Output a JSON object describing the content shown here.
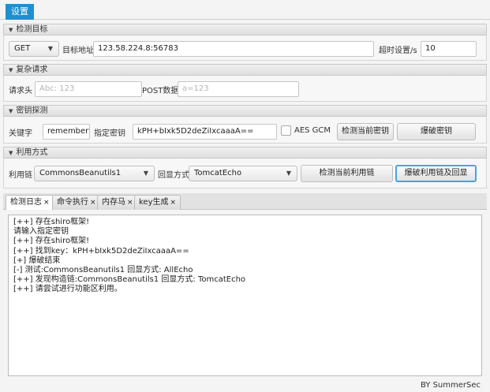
{
  "menubar": {
    "settings": "设置"
  },
  "target": {
    "header": "检测目标",
    "method": "GET",
    "url_label": "目标地址",
    "url_value": "123.58.224.8:56783",
    "timeout_label": "超时设置/s",
    "timeout_value": "10"
  },
  "complex": {
    "header": "复杂请求",
    "headers_label": "请求头",
    "headers_placeholder": "Abc: 123",
    "post_label": "POST数据",
    "post_placeholder": "a=123"
  },
  "key_probe": {
    "header": "密钥探测",
    "keyword_label": "关键字",
    "keyword_value": "rememberf",
    "specify_label": "指定密钥",
    "key_value": "kPH+bIxk5D2deZiIxcaaaA==",
    "aes_gcm_label": "AES GCM",
    "detect_key_btn": "检测当前密钥",
    "brute_key_btn": "爆破密钥"
  },
  "exploit": {
    "header": "利用方式",
    "chain_label": "利用链",
    "chain_value": "CommonsBeanutils1",
    "echo_label": "回显方式",
    "echo_value": "TomcatEcho",
    "detect_chain_btn": "检测当前利用链",
    "brute_chain_btn": "爆破利用链及回显"
  },
  "tabs": [
    {
      "label": "检测日志"
    },
    {
      "label": "命令执行"
    },
    {
      "label": "内存马"
    },
    {
      "label": "key生成"
    }
  ],
  "tab_close": "×",
  "log_lines": [
    "[++] 存在shiro框架!",
    "请输入指定密钥",
    "[++] 存在shiro框架!",
    "[++] 找到key：kPH+bIxk5D2deZiIxcaaaA==",
    "[+] 爆破结束",
    "[-] 测试:CommonsBeanutils1  回显方式: AllEcho",
    "[++] 发现构造链:CommonsBeanutils1  回显方式: TomcatEcho",
    "[++] 请尝试进行功能区利用。"
  ],
  "footer": "BY  SummerSec"
}
